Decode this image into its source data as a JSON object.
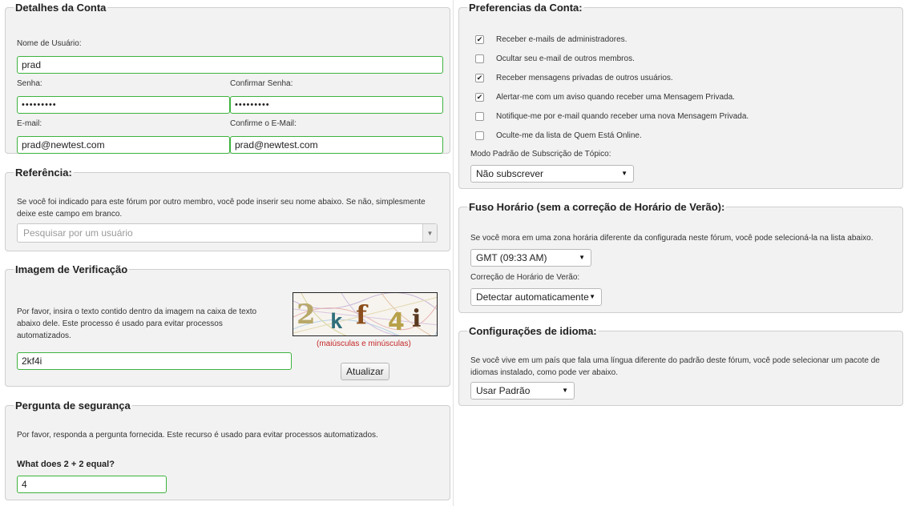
{
  "account": {
    "legend": "Detalhes da Conta",
    "username_label": "Nome de Usuário:",
    "username_value": "prad",
    "password_label": "Senha:",
    "password_value": "•••••••••",
    "confirm_password_label": "Confirmar Senha:",
    "confirm_password_value": "•••••••••",
    "email_label": "E-mail:",
    "email_value": "prad@newtest.com",
    "confirm_email_label": "Confirme o E-Mail:",
    "confirm_email_value": "prad@newtest.com"
  },
  "referral": {
    "legend": "Referência:",
    "description": "Se você foi indicado para este fórum por outro membro, você pode inserir seu nome abaixo. Se não, simplesmente deixe este campo em branco.",
    "search_placeholder": "Pesquisar por um usuário"
  },
  "verification": {
    "legend": "Imagem de Verificação",
    "description": "Por favor, insira o texto contido dentro da imagem na caixa de texto abaixo dele. Este processo é usado para evitar processos automatizados.",
    "captcha_chars": [
      "2",
      "k",
      "f",
      "4",
      "i"
    ],
    "case_note": "(maiúsculas e minúsculas)",
    "input_value": "2kf4i",
    "refresh_label": "Atualizar"
  },
  "security": {
    "legend": "Pergunta de segurança",
    "description": "Por favor, responda a pergunta fornecida. Este recurso é usado para evitar processos automatizados.",
    "question": "What does 2 + 2 equal?",
    "answer_value": "4"
  },
  "preferences": {
    "legend": "Preferencias da Conta:",
    "options": [
      {
        "label": "Receber e-mails de administradores.",
        "checked": true
      },
      {
        "label": "Ocultar seu e-mail de outros membros.",
        "checked": false
      },
      {
        "label": "Receber mensagens privadas de outros usuários.",
        "checked": true
      },
      {
        "label": "Alertar-me com um aviso quando receber uma Mensagem Privada.",
        "checked": true
      },
      {
        "label": "Notifique-me por e-mail quando receber uma nova Mensagem Privada.",
        "checked": false
      },
      {
        "label": "Oculte-me da lista de Quem Está Online.",
        "checked": false
      }
    ],
    "subscription_label": "Modo Padrão de Subscrição de Tópico:",
    "subscription_value": "Não subscrever"
  },
  "timezone": {
    "legend": "Fuso Horário (sem a correção de Horário de Verão):",
    "description": "Se você mora em uma zona horária diferente da configurada neste fórum, você pode selecioná-la na lista abaixo.",
    "timezone_value": "GMT (09:33 AM)",
    "dst_label": "Correção de Horário de Verão:",
    "dst_value": "Detectar automaticamente"
  },
  "language": {
    "legend": "Configurações de idioma:",
    "description": "Se você vive em um país que fala uma língua diferente do padrão deste fórum, você pode selecionar um pacote de idiomas instalado, como pode ver abaixo.",
    "language_value": "Usar Padrão"
  },
  "colors": {
    "valid_border": "#3db33d",
    "captcha_note": "#c62828",
    "panel_bg": "#f2f2f2"
  }
}
